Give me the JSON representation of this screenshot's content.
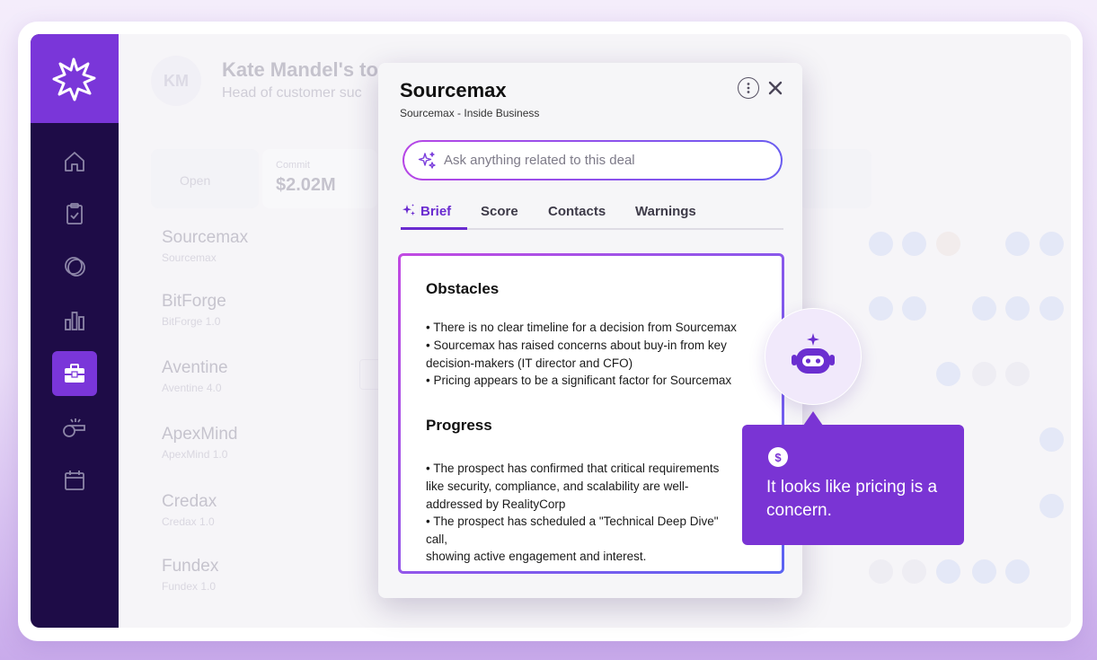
{
  "background": {
    "avatar_initials": "KM",
    "title": "Kate Mandel's to",
    "subtitle": "Head of customer suc",
    "open_label": "Open",
    "commit_label": "Commit",
    "commit_value": "$2.02M",
    "rows": [
      {
        "name": "Sourcemax",
        "sub": "Sourcemax"
      },
      {
        "name": "BitForge",
        "sub": "BitForge 1.0"
      },
      {
        "name": "Aventine",
        "sub": "Aventine 4.0"
      },
      {
        "name": "ApexMind",
        "sub": "ApexMind 1.0"
      },
      {
        "name": "Credax",
        "sub": "Credax 1.0"
      },
      {
        "name": "Fundex",
        "sub": "Fundex 1.0"
      }
    ]
  },
  "sidebar": {
    "items": [
      {
        "icon": "home-icon"
      },
      {
        "icon": "clipboard-icon"
      },
      {
        "icon": "chat-icon"
      },
      {
        "icon": "bar-chart-icon"
      },
      {
        "icon": "briefcase-icon",
        "active": true
      },
      {
        "icon": "whistle-icon"
      },
      {
        "icon": "calendar-icon"
      }
    ]
  },
  "modal": {
    "title": "Sourcemax",
    "subtitle": "Sourcemax - Inside Business",
    "ask_placeholder": "Ask anything related to this deal",
    "tabs": [
      {
        "label": "Brief",
        "active": true
      },
      {
        "label": "Score"
      },
      {
        "label": "Contacts"
      },
      {
        "label": "Warnings"
      }
    ],
    "obstacles": {
      "title": "Obstacles",
      "lines": [
        "• There is no clear timeline for a decision from Sourcemax",
        "• Sourcemax has raised concerns about buy-in from key",
        "decision-makers (IT director and CFO)",
        "• Pricing appears to be a significant factor for Sourcemax"
      ]
    },
    "progress": {
      "title": "Progress",
      "lines": [
        "• The prospect has confirmed that critical requirements",
        "like security, compliance, and scalability are well-",
        "addressed by RealityCorp",
        "•  The prospect has scheduled a \"Technical Deep Dive\"",
        "call,",
        "showing active engagement and interest."
      ]
    }
  },
  "callout": {
    "coin_symbol": "$",
    "text": "It looks like pricing is a concern."
  },
  "colors": {
    "sidebar": "#1e0c47",
    "accent": "#7a36d9",
    "callout": "#7a34d4",
    "tab_active": "#6a2bd0"
  }
}
